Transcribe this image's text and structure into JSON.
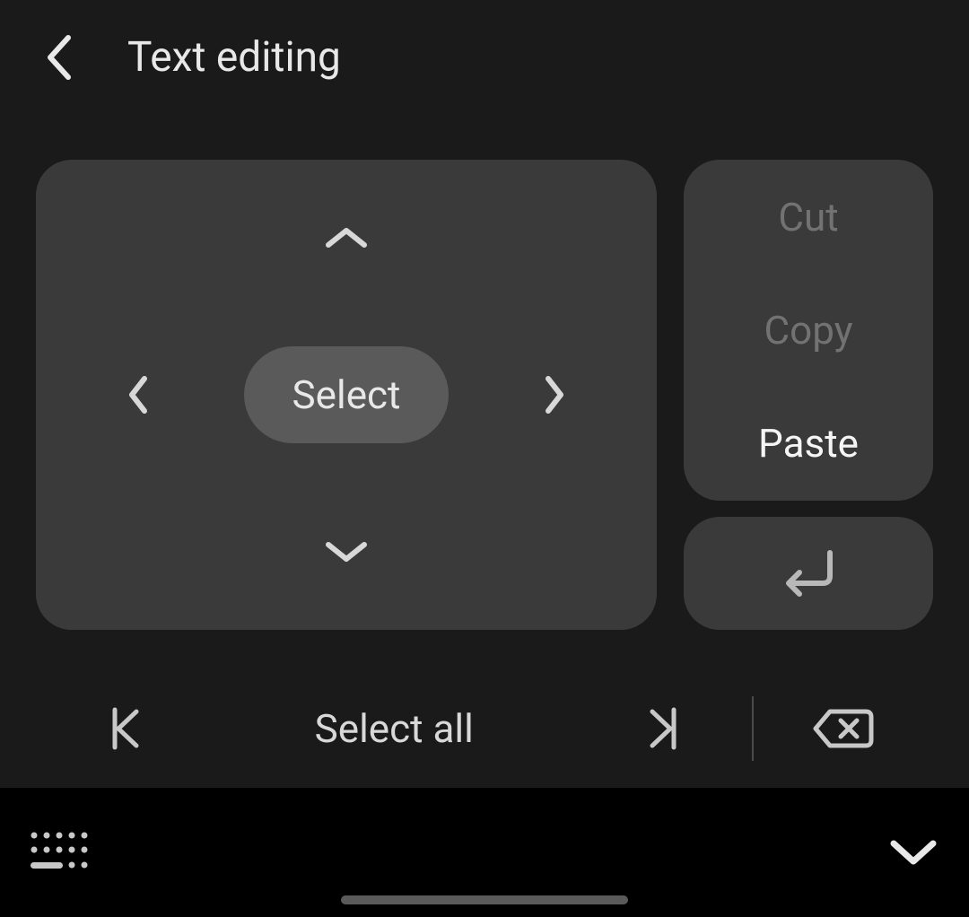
{
  "header": {
    "title": "Text editing"
  },
  "dpad": {
    "select_label": "Select"
  },
  "clipboard": {
    "cut_label": "Cut",
    "cut_enabled": false,
    "copy_label": "Copy",
    "copy_enabled": false,
    "paste_label": "Paste",
    "paste_enabled": true
  },
  "bottom": {
    "select_all_label": "Select all"
  }
}
